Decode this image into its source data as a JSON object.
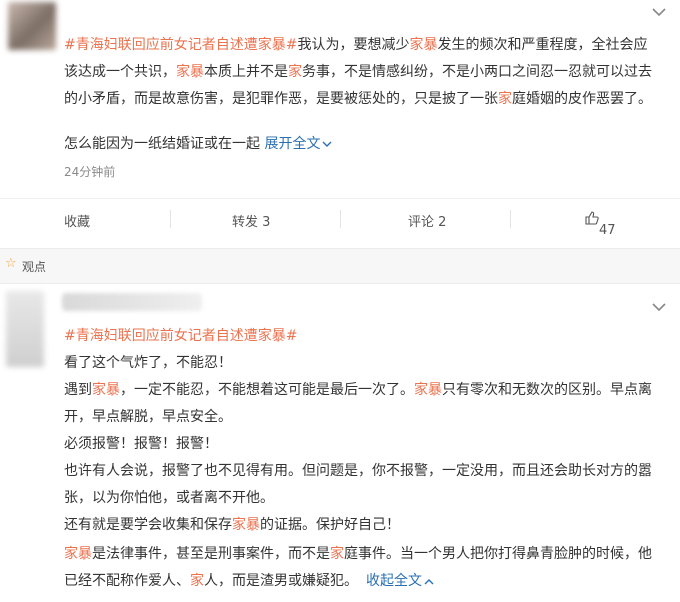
{
  "post1": {
    "lines": [
      [
        {
          "t": "#青海妇联回应前女记者自述遭家暴#",
          "c": "link"
        },
        {
          "t": "我认为，要想减少",
          "c": ""
        },
        {
          "t": "家暴",
          "c": "red"
        },
        {
          "t": "发生的频次和严重程度，全社会应",
          "c": ""
        }
      ],
      [
        {
          "t": "该达成一个共识，",
          "c": ""
        },
        {
          "t": "家暴",
          "c": "red"
        },
        {
          "t": "本质上并不是",
          "c": ""
        },
        {
          "t": "家",
          "c": "red"
        },
        {
          "t": "务事，不是情感纠纷，不是小两口之间忍一忍就可以过去",
          "c": ""
        }
      ],
      [
        {
          "t": "的小矛盾，而是故意伤害，是犯罪作恶，是要被惩处的，只是披了一张",
          "c": ""
        },
        {
          "t": "家",
          "c": "red"
        },
        {
          "t": "庭婚姻的皮作恶罢了。",
          "c": ""
        }
      ]
    ],
    "last_line": "怎么能因为一纸结婚证或在一起",
    "expand": "展开全文",
    "time": "24分钟前",
    "actions": {
      "collect": "收藏",
      "repost": "转发 3",
      "comment": "评论 2",
      "like": "47"
    }
  },
  "section_label": "观点",
  "post2": {
    "lines": [
      [
        {
          "t": "#青海妇联回应前女记者自述遭家暴#",
          "c": "link"
        }
      ],
      [
        {
          "t": "看了这个气炸了，不能忍！",
          "c": ""
        }
      ],
      [
        {
          "t": "遇到",
          "c": ""
        },
        {
          "t": "家暴",
          "c": "red"
        },
        {
          "t": "，一定不能忍，不能想着这可能是最后一次了。",
          "c": ""
        },
        {
          "t": "家暴",
          "c": "red"
        },
        {
          "t": "只有零次和无数次的区别。早点离",
          "c": ""
        }
      ],
      [
        {
          "t": "开，早点解脱，早点安全。",
          "c": ""
        }
      ],
      [
        {
          "t": "必须报警！报警！报警！",
          "c": ""
        }
      ],
      [
        {
          "t": "也许有人会说，报警了也不见得有用。但问题是，你不报警，一定没用，而且还会助长对方的嚣",
          "c": ""
        }
      ],
      [
        {
          "t": "张，以为你怕他，或者离不开他。",
          "c": ""
        }
      ],
      [
        {
          "t": "还有就是要学会收集和保存",
          "c": ""
        },
        {
          "t": "家暴",
          "c": "red"
        },
        {
          "t": "的证据。保护好自己！",
          "c": ""
        }
      ]
    ],
    "lines_b": [
      [
        {
          "t": "家暴",
          "c": "red"
        },
        {
          "t": "是法律事件，甚至是刑事案件，而不是",
          "c": ""
        },
        {
          "t": "家",
          "c": "red"
        },
        {
          "t": "庭事件。当一个男人把你打得鼻青脸肿的时候，他",
          "c": ""
        }
      ],
      [
        {
          "t": "已经不配称作爱人、",
          "c": ""
        },
        {
          "t": "家",
          "c": "red"
        },
        {
          "t": "人，而是渣男或嫌疑犯。",
          "c": ""
        }
      ]
    ],
    "collapse": "收起全文"
  },
  "colors": {
    "accent": "#eb7350",
    "link_blue": "#2a6fb2"
  },
  "icons": {
    "chevron": "chevron-down-icon",
    "like": "thumbs-up-icon",
    "section": "star-icon"
  }
}
